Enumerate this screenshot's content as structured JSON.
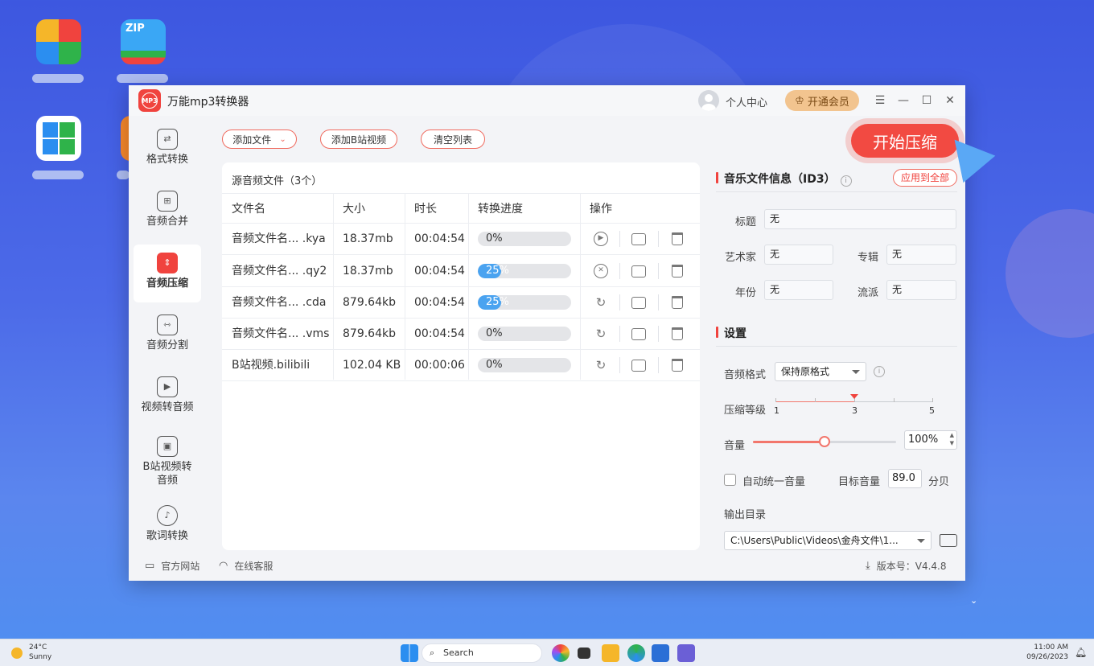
{
  "app": {
    "title": "万能mp3转换器",
    "logo_text": "MP3"
  },
  "header": {
    "user_center": "个人中心",
    "vip_label": "开通会员",
    "vip_icon": "crown-icon"
  },
  "window_controls": {
    "menu": "☰",
    "minimize": "—",
    "maximize": "☐",
    "close": "✕"
  },
  "sidebar": {
    "items": [
      {
        "label": "格式转换",
        "icon": "format-convert-icon",
        "glyph": "⇄",
        "active": false
      },
      {
        "label": "音频合并",
        "icon": "audio-merge-icon",
        "glyph": "⊞",
        "active": false
      },
      {
        "label": "音频压缩",
        "icon": "audio-compress-icon",
        "glyph": "⇕",
        "active": true
      },
      {
        "label": "音频分割",
        "icon": "audio-split-icon",
        "glyph": "⇿",
        "active": false
      },
      {
        "label": "视频转音频",
        "icon": "video-to-audio-icon",
        "glyph": "▶",
        "active": false
      },
      {
        "label": "B站视频转\n音频",
        "label_line1": "B站视频转",
        "label_line2": "音频",
        "icon": "bilibili-icon",
        "glyph": "▣",
        "active": false
      },
      {
        "label": "歌词转换",
        "icon": "lyrics-icon",
        "glyph": "♪",
        "active": false
      }
    ]
  },
  "toolbar": {
    "add_file": "添加文件",
    "add_bilibili": "添加B站视频",
    "clear_list": "清空列表",
    "start": "开始压缩"
  },
  "file_list": {
    "title": "源音频文件（3个）",
    "columns": [
      "文件名",
      "大小",
      "时长",
      "转换进度",
      "操作"
    ],
    "rows": [
      {
        "name": "音频文件名... .kya",
        "size": "18.37mb",
        "duration": "00:04:54",
        "progress": "0%",
        "progress_value": 0,
        "action_icon": "play-icon",
        "action_glyph": "▶"
      },
      {
        "name": "音频文件名... .qy2",
        "size": "18.37mb",
        "duration": "00:04:54",
        "progress": "25%",
        "progress_value": 25,
        "action_icon": "cancel-icon",
        "action_glyph": "✕"
      },
      {
        "name": "音频文件名... .cda",
        "size": "879.64kb",
        "duration": "00:04:54",
        "progress": "25%",
        "progress_value": 25,
        "action_icon": "retry-icon",
        "action_glyph": "↻"
      },
      {
        "name": "音频文件名... .vms",
        "size": "879.64kb",
        "duration": "00:04:54",
        "progress": "0%",
        "progress_value": 0,
        "action_icon": "retry-icon",
        "action_glyph": "↻"
      },
      {
        "name": "B站视频.bilibili",
        "size": "102.04 KB",
        "duration": "00:00:06",
        "progress": "0%",
        "progress_value": 0,
        "action_icon": "retry-icon",
        "action_glyph": "↻"
      }
    ]
  },
  "id3": {
    "title": "音乐文件信息（ID3）",
    "apply_all": "应用到全部",
    "fields": {
      "title_label": "标题",
      "title_value": "无",
      "artist_label": "艺术家",
      "artist_value": "无",
      "album_label": "专辑",
      "album_value": "无",
      "year_label": "年份",
      "year_value": "无",
      "genre_label": "流派",
      "genre_value": "无"
    }
  },
  "settings": {
    "title": "设置",
    "format_label": "音频格式",
    "format_value": "保持原格式",
    "level_label": "压缩等级",
    "level_ticks": [
      "1",
      "3",
      "5"
    ],
    "level_value": 3,
    "level_min": 1,
    "level_max": 5,
    "volume_label": "音量",
    "volume_value": "100%",
    "volume_fraction": 0.5,
    "auto_normalize_label": "自动统一音量",
    "auto_normalize_checked": false,
    "target_volume_label": "目标音量",
    "target_volume_value": "89.0",
    "target_volume_unit": "分贝",
    "output_label": "输出目录",
    "output_value": "C:\\Users\\Public\\Videos\\金舟文件\\1..."
  },
  "footer": {
    "website": "官方网站",
    "support": "在线客服",
    "version": "版本号：V4.4.8"
  },
  "taskbar": {
    "weather_temp": "24°C",
    "weather_desc": "Sunny",
    "search": "Search",
    "time": "11:00 AM",
    "date": "09/26/2023"
  },
  "colors": {
    "accent": "#f0433e",
    "progress": "#4aa3f0",
    "vip": "#f2c48f"
  }
}
